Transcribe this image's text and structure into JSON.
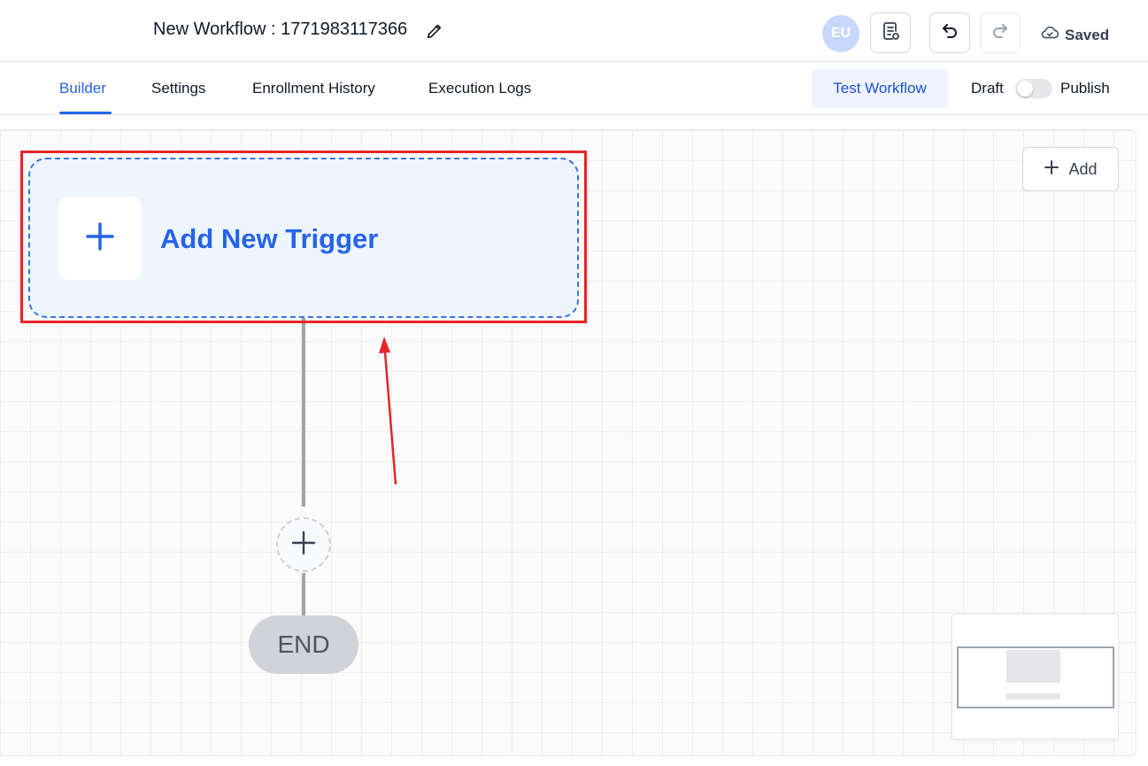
{
  "header": {
    "workflow_title": "New Workflow : 1771983117366",
    "avatar_initials": "EU",
    "status_label": "Saved"
  },
  "tabs": [
    {
      "label": "Builder",
      "active": true
    },
    {
      "label": "Settings",
      "active": false
    },
    {
      "label": "Enrollment History",
      "active": false
    },
    {
      "label": "Execution Logs",
      "active": false
    }
  ],
  "actions": {
    "test_label": "Test Workflow",
    "draft_label": "Draft",
    "publish_label": "Publish",
    "publish_enabled": false
  },
  "canvas": {
    "add_label": "Add",
    "trigger_label": "Add New Trigger",
    "end_label": "END"
  },
  "colors": {
    "accent": "#2563eb",
    "highlight": "#e5252a",
    "trigger_bg": "#eef5fe"
  },
  "icons": [
    "pencil-icon",
    "notes-icon",
    "undo-icon",
    "redo-icon",
    "cloud-check-icon",
    "plus-icon"
  ]
}
